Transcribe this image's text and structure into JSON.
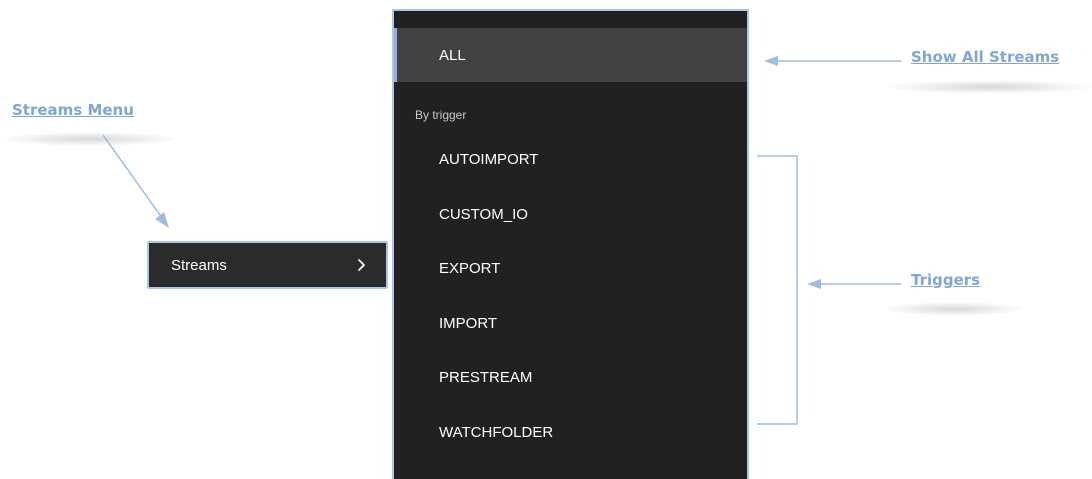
{
  "annotations": {
    "show_all_streams": "Show All Streams",
    "streams_menu": "Streams Menu",
    "triggers": "Triggers"
  },
  "main_menu": {
    "label": "Streams",
    "icon": "chevron-right-icon"
  },
  "submenu": {
    "all_label": "ALL",
    "section_label": "By trigger",
    "triggers": [
      "AUTOIMPORT",
      "CUSTOM_IO",
      "EXPORT",
      "IMPORT",
      "PRESTREAM",
      "WATCHFOLDER"
    ]
  },
  "colors": {
    "annotation": "#7fa6d9",
    "highlight_border": "#a9c5ea",
    "menu_bg": "#2b2b2b",
    "submenu_bg": "#212121",
    "selected_item_bg": "#424242",
    "text": "#ffffff"
  }
}
